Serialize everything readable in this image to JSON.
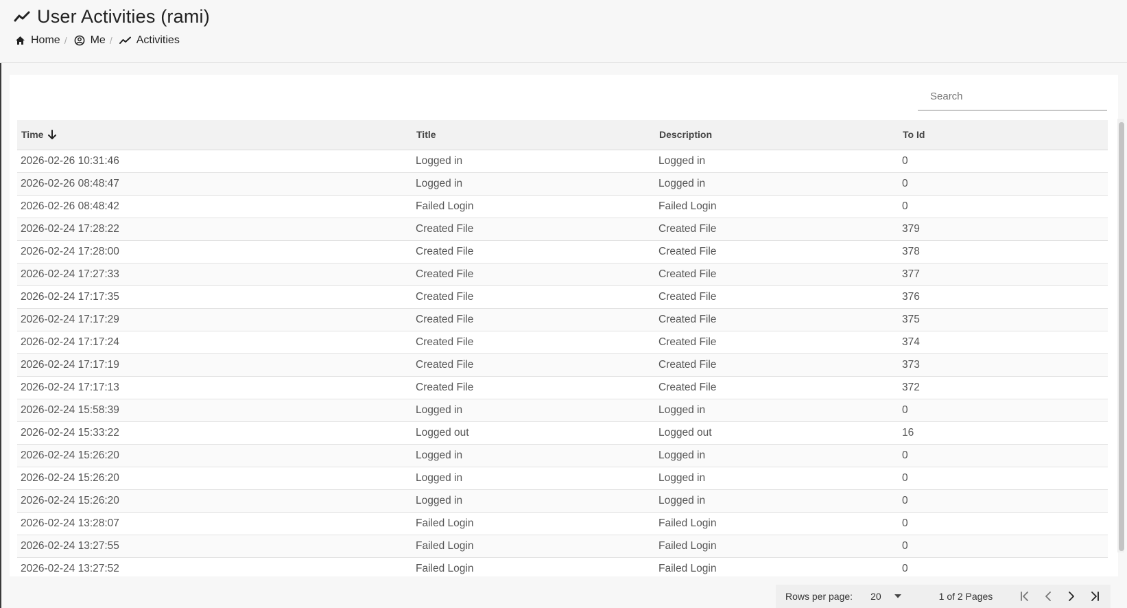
{
  "header": {
    "title": "User Activities (rami)",
    "breadcrumb": [
      {
        "label": "Home",
        "icon": "home-icon"
      },
      {
        "label": "Me",
        "icon": "user-circle-icon"
      },
      {
        "label": "Activities",
        "icon": "trend-icon"
      }
    ],
    "separator": "/"
  },
  "search": {
    "placeholder": "Search",
    "value": ""
  },
  "table": {
    "columns": [
      "Time",
      "Title",
      "Description",
      "To Id"
    ],
    "sort": {
      "column": "Time",
      "direction": "descending"
    },
    "rows": [
      [
        "2026-02-26 10:31:46",
        "Logged in",
        "Logged in",
        "0"
      ],
      [
        "2026-02-26 08:48:47",
        "Logged in",
        "Logged in",
        "0"
      ],
      [
        "2026-02-26 08:48:42",
        "Failed Login",
        "Failed Login",
        "0"
      ],
      [
        "2026-02-24 17:28:22",
        "Created File",
        "Created File",
        "379"
      ],
      [
        "2026-02-24 17:28:00",
        "Created File",
        "Created File",
        "378"
      ],
      [
        "2026-02-24 17:27:33",
        "Created File",
        "Created File",
        "377"
      ],
      [
        "2026-02-24 17:17:35",
        "Created File",
        "Created File",
        "376"
      ],
      [
        "2026-02-24 17:17:29",
        "Created File",
        "Created File",
        "375"
      ],
      [
        "2026-02-24 17:17:24",
        "Created File",
        "Created File",
        "374"
      ],
      [
        "2026-02-24 17:17:19",
        "Created File",
        "Created File",
        "373"
      ],
      [
        "2026-02-24 17:17:13",
        "Created File",
        "Created File",
        "372"
      ],
      [
        "2026-02-24 15:58:39",
        "Logged in",
        "Logged in",
        "0"
      ],
      [
        "2026-02-24 15:33:22",
        "Logged out",
        "Logged out",
        "16"
      ],
      [
        "2026-02-24 15:26:20",
        "Logged in",
        "Logged in",
        "0"
      ],
      [
        "2026-02-24 15:26:20",
        "Logged in",
        "Logged in",
        "0"
      ],
      [
        "2026-02-24 15:26:20",
        "Logged in",
        "Logged in",
        "0"
      ],
      [
        "2026-02-24 13:28:07",
        "Failed Login",
        "Failed Login",
        "0"
      ],
      [
        "2026-02-24 13:27:55",
        "Failed Login",
        "Failed Login",
        "0"
      ],
      [
        "2026-02-24 13:27:52",
        "Failed Login",
        "Failed Login",
        "0"
      ]
    ]
  },
  "footer": {
    "rows_per_page_label": "Rows per page:",
    "rows_per_page_value": "20",
    "page_info": "1 of 2 Pages"
  }
}
